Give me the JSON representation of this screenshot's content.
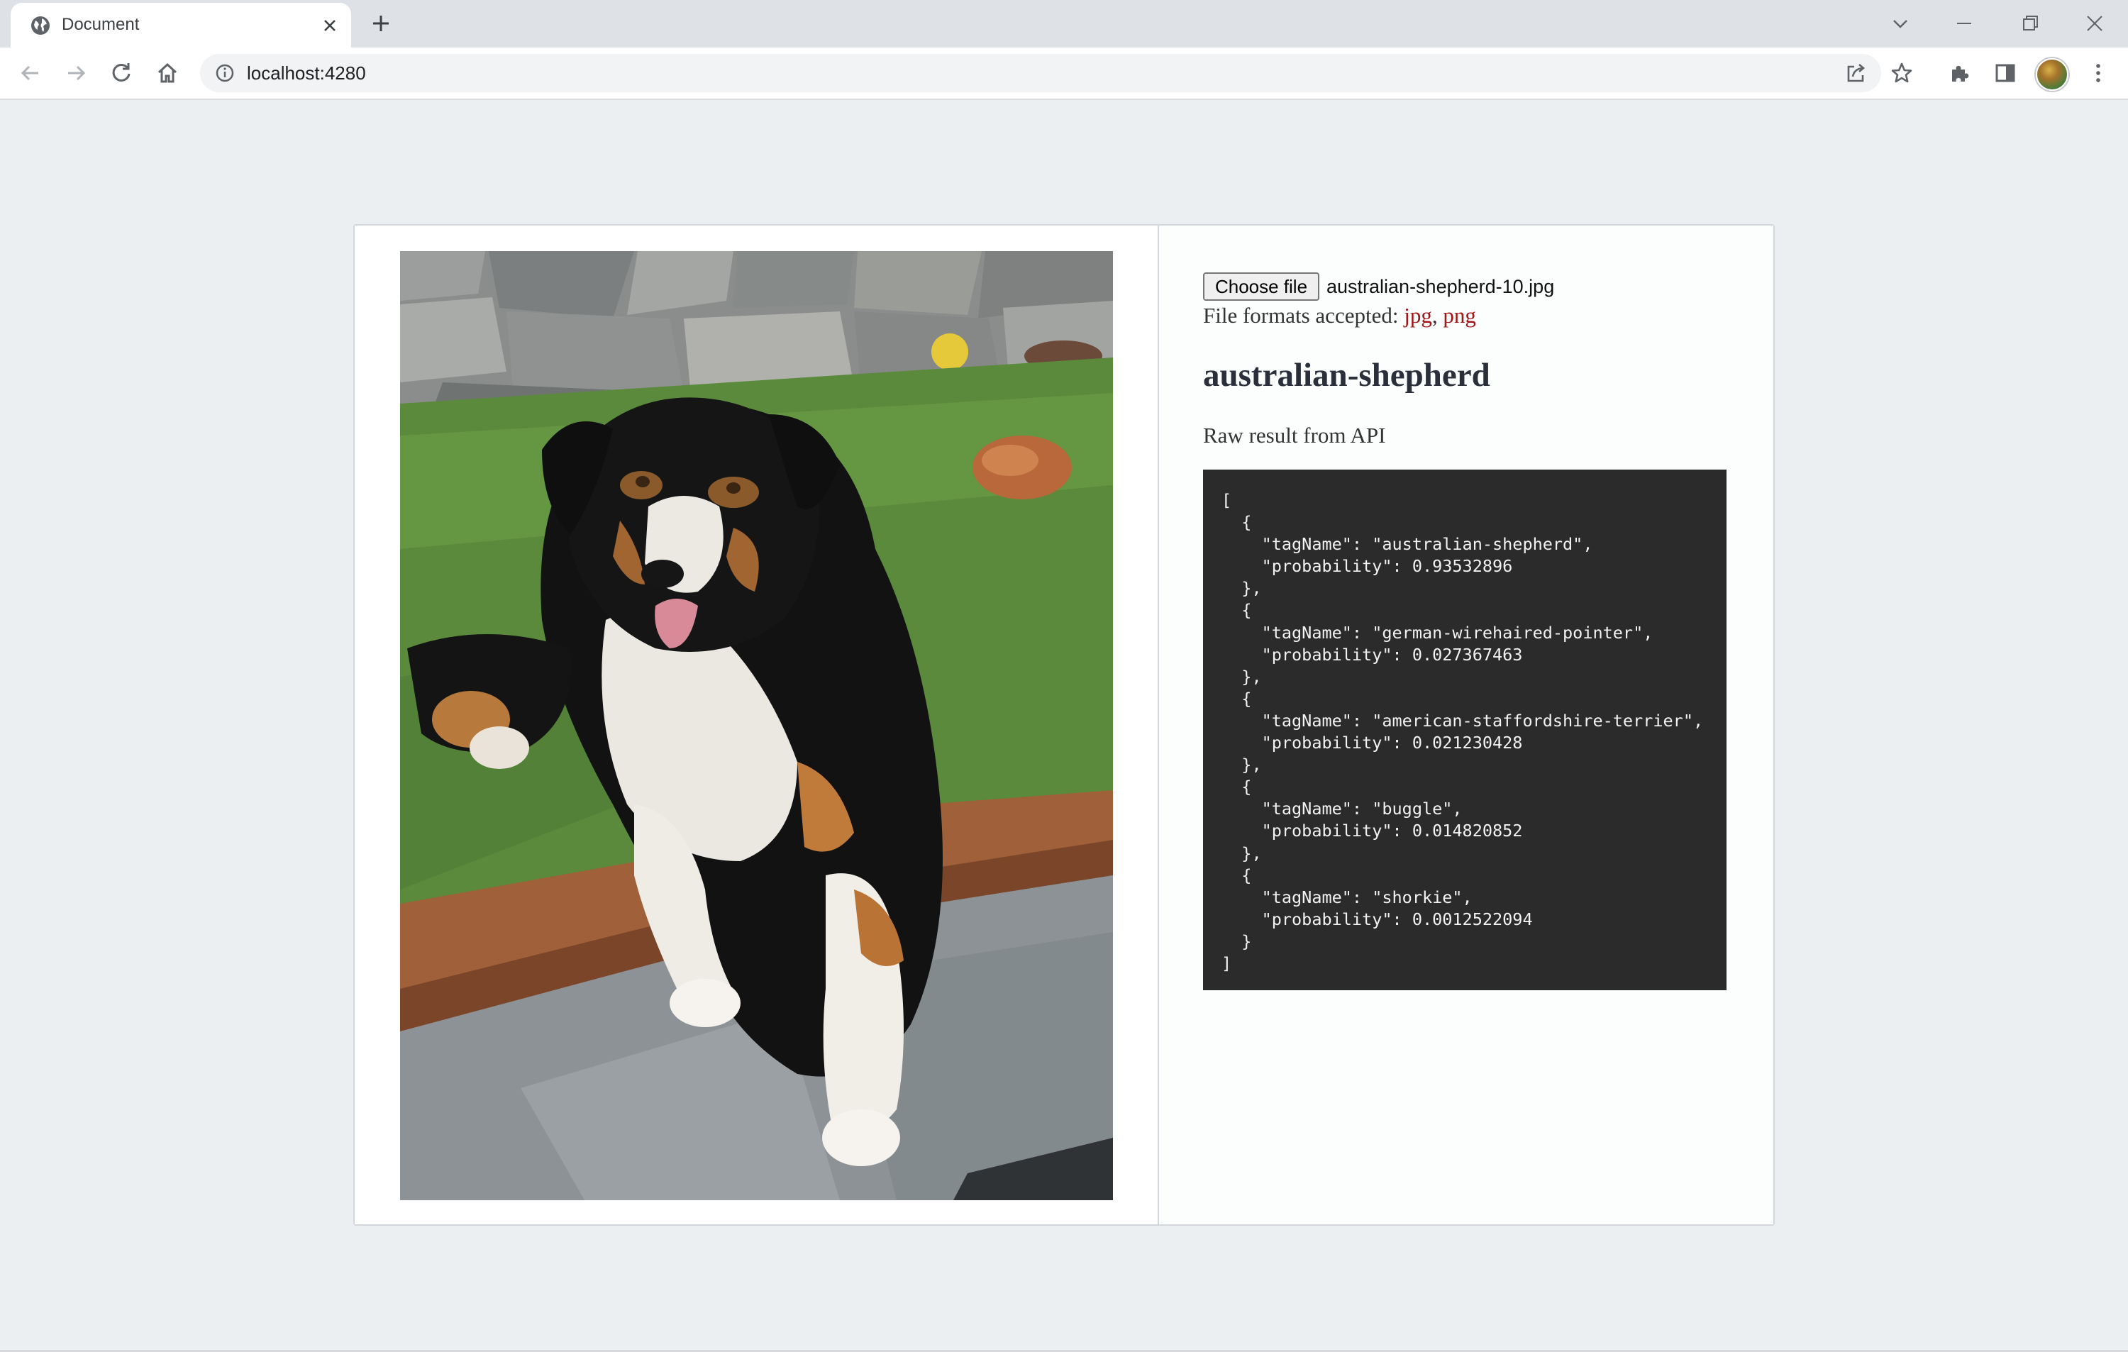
{
  "browser": {
    "tab_title": "Document",
    "url": "localhost:4280"
  },
  "upload": {
    "button_label": "Choose file",
    "file_name": "australian-shepherd-10.jpg",
    "formats_prefix": "File formats accepted: ",
    "formats": [
      "jpg",
      "png"
    ],
    "formats_separator": ", "
  },
  "result": {
    "top_tag": "australian-shepherd",
    "raw_label": "Raw result from API"
  },
  "predictions": [
    {
      "tagName": "australian-shepherd",
      "probability": "0.93532896"
    },
    {
      "tagName": "german-wirehaired-pointer",
      "probability": "0.027367463"
    },
    {
      "tagName": "american-staffordshire-terrier",
      "probability": "0.021230428"
    },
    {
      "tagName": "buggle",
      "probability": "0.014820852"
    },
    {
      "tagName": "shorkie",
      "probability": "0.0012522094"
    }
  ],
  "colors": {
    "page_background": "#eceff2",
    "code_background": "#2b2b2b",
    "link_red": "#a31515"
  },
  "icons": [
    "globe-icon",
    "close-icon",
    "plus-icon",
    "chevron-down-icon",
    "minimize-icon",
    "restore-icon",
    "back-arrow-icon",
    "forward-arrow-icon",
    "reload-icon",
    "home-icon",
    "info-icon",
    "share-icon",
    "star-icon",
    "puzzle-icon",
    "side-panel-icon",
    "kebab-menu-icon"
  ]
}
